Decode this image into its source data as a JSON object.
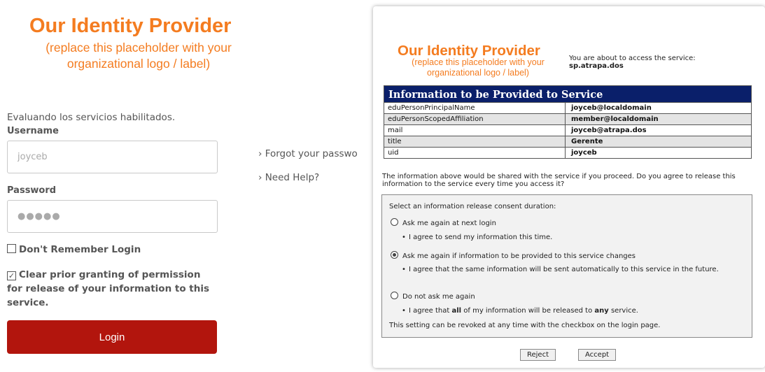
{
  "left": {
    "brand_title": "Our Identity Provider",
    "brand_sub": "(replace this placeholder with your organizational logo / label)",
    "status": "Evaluando los servicios habilitados.",
    "username_label": "Username",
    "username_value": "joyceb",
    "password_label": "Password",
    "password_value": "●●●●●",
    "dont_remember": "Don't Remember Login",
    "clear_prior": "Clear prior granting of permission for release of your information to this service.",
    "login_button": "Login",
    "forgot_link": "› Forgot your passwo",
    "help_link": "› Need Help?"
  },
  "dialog": {
    "brand_title": "Our Identity Provider",
    "brand_sub": "(replace this placeholder with your organizational logo / label)",
    "access_text": "You are about to access the service:",
    "service": "sp.atrapa.dos",
    "table_header": "Information to be Provided to Service",
    "attributes": [
      {
        "name": "eduPersonPrincipalName",
        "value": "joyceb@localdomain"
      },
      {
        "name": "eduPersonScopedAffiliation",
        "value": "member@localdomain"
      },
      {
        "name": "mail",
        "value": "joyceb@atrapa.dos"
      },
      {
        "name": "title",
        "value": "Gerente"
      },
      {
        "name": "uid",
        "value": "joyceb"
      }
    ],
    "share_text": "The information above would be shared with the service if you proceed. Do you agree to release this information to the service every time you access it?",
    "consent_title": "Select an information release consent duration:",
    "option1": "Ask me again at next login",
    "option1_desc": "I agree to send my information this time.",
    "option2": "Ask me again if information to be provided to this service changes",
    "option2_desc": "I agree that the same information will be sent automatically to this service in the future.",
    "option3": "Do not ask me again",
    "option3_desc_a": "I agree that ",
    "option3_desc_b": "all",
    "option3_desc_c": " of my information will be released to ",
    "option3_desc_d": "any",
    "option3_desc_e": " service.",
    "revoke_text": "This setting can be revoked at any time with the checkbox on the login page.",
    "reject_button": "Reject",
    "accept_button": "Accept",
    "selected_option": 2
  }
}
